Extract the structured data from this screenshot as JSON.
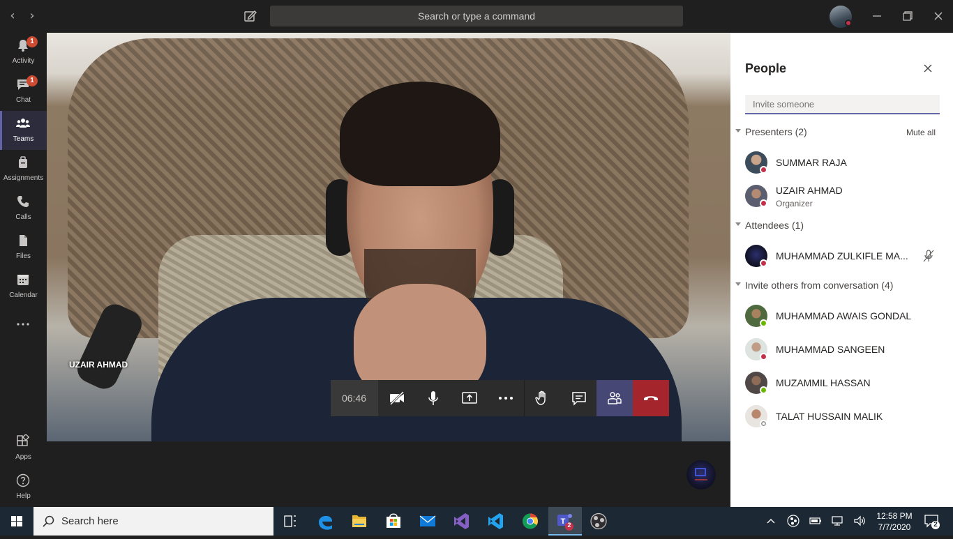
{
  "titlebar": {
    "search_placeholder": "Search or type a command",
    "colors": {
      "bg": "#201f1f",
      "search_bg": "#3b3a39"
    }
  },
  "appbar": {
    "items": [
      {
        "label": "Activity",
        "icon": "bell-icon",
        "badge": "1"
      },
      {
        "label": "Chat",
        "icon": "chat-icon",
        "badge": "1"
      },
      {
        "label": "Teams",
        "icon": "teams-icon",
        "active": true
      },
      {
        "label": "Assignments",
        "icon": "assignments-icon"
      },
      {
        "label": "Calls",
        "icon": "phone-icon"
      },
      {
        "label": "Files",
        "icon": "file-icon"
      },
      {
        "label": "Calendar",
        "icon": "calendar-icon"
      }
    ],
    "bottom": [
      {
        "label": "Apps",
        "icon": "apps-icon"
      },
      {
        "label": "Help",
        "icon": "help-icon"
      }
    ]
  },
  "meeting": {
    "participant_name": "UZAIR AHMAD",
    "timer": "06:46",
    "controls": [
      "camera-off-icon",
      "microphone-icon",
      "share-screen-icon",
      "more-icon",
      "raise-hand-icon",
      "chat-icon",
      "people-icon",
      "hang-up-icon"
    ],
    "colors": {
      "people_active": "#464775",
      "hangup": "#a4262c"
    }
  },
  "panel": {
    "title": "People",
    "invite_placeholder": "Invite someone",
    "presenters": {
      "title": "Presenters (2)",
      "action": "Mute all",
      "people": [
        {
          "name": "SUMMAR RAJA",
          "status": "busy"
        },
        {
          "name": "UZAIR AHMAD",
          "role": "Organizer",
          "status": "busy"
        }
      ]
    },
    "attendees": {
      "title": "Attendees (1)",
      "people": [
        {
          "name": "MUHAMMAD ZULKIFLE MA...",
          "status": "busy",
          "muted": true
        }
      ]
    },
    "invite_others": {
      "title": "Invite others from conversation (4)",
      "people": [
        {
          "name": "MUHAMMAD AWAIS GONDAL",
          "status": "available"
        },
        {
          "name": "MUHAMMAD SANGEEN",
          "status": "busy"
        },
        {
          "name": "MUZAMMIL HASSAN",
          "status": "available"
        },
        {
          "name": "TALAT HUSSAIN MALIK",
          "status": "offline"
        }
      ]
    },
    "colors": {
      "accent": "#6264a7",
      "busy": "#c4314b",
      "available": "#6bb700"
    }
  },
  "taskbar": {
    "search_placeholder": "Search here",
    "time": "12:58 PM",
    "date": "7/7/2020",
    "notification_count": "2",
    "teams_badge": "2",
    "apps": [
      "task-view-icon",
      "edge-icon",
      "file-explorer-icon",
      "store-icon",
      "mail-icon",
      "visual-studio-icon",
      "vscode-icon",
      "chrome-icon",
      "teams-icon",
      "obs-icon"
    ]
  }
}
